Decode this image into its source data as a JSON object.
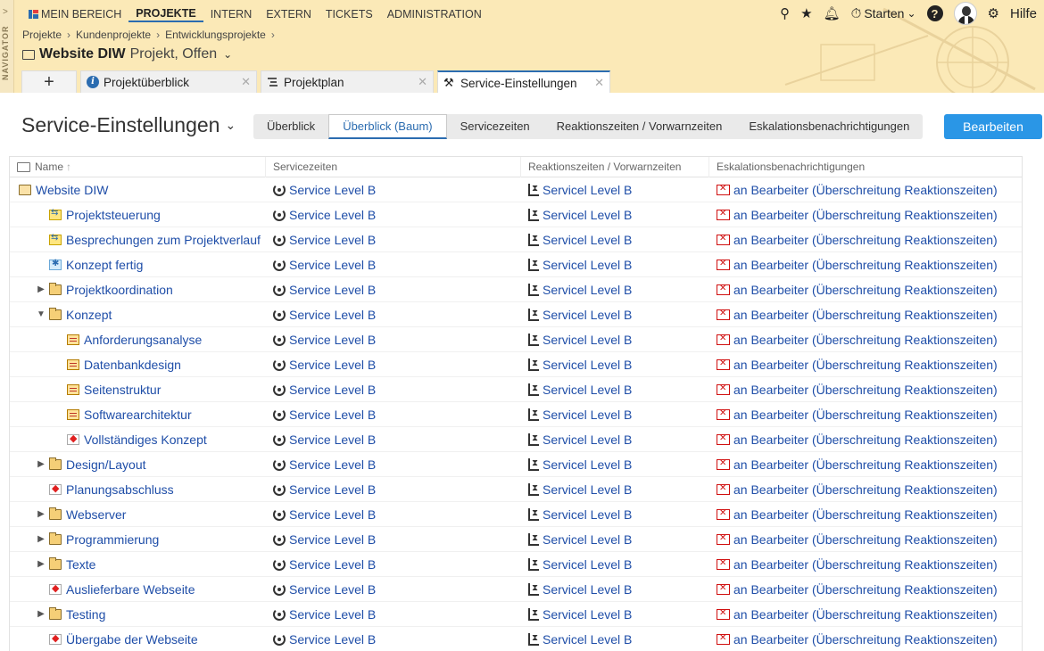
{
  "navigator": {
    "label": "NAVIGATOR"
  },
  "topnav": {
    "items": [
      "MEIN BEREICH",
      "PROJEKTE",
      "INTERN",
      "EXTERN",
      "TICKETS",
      "ADMINISTRATION"
    ],
    "active": "PROJEKTE"
  },
  "tools": {
    "start_label": "Starten",
    "help_label": "Hilfe"
  },
  "breadcrumb": [
    "Projekte",
    "Kundenprojekte",
    "Entwicklungsprojekte"
  ],
  "project": {
    "name": "Website DIW",
    "status": "Projekt, Offen"
  },
  "tabs": [
    "Projektüberblick",
    "Projektplan",
    "Service-Einstellungen"
  ],
  "page": {
    "title": "Service-Einstellungen",
    "view_tabs": [
      "Überblick",
      "Überblick (Baum)",
      "Servicezeiten",
      "Reaktionszeiten / Vorwarnzeiten",
      "Eskalationsbenachrichtigungen"
    ],
    "edit_label": "Bearbeiten"
  },
  "table": {
    "headers": [
      "Name",
      "Servicezeiten",
      "Reaktionszeiten / Vorwarnzeiten",
      "Eskalationsbenachrichtigungen"
    ],
    "rows": [
      {
        "name": "Website DIW",
        "type": "root",
        "indent": 0,
        "expander": "",
        "service": "Service Level B",
        "reaction": "Servicel Level B",
        "escalation": "an Bearbeiter (Überschreitung Reaktionszeiten)"
      },
      {
        "name": "Projektsteuerung",
        "type": "meet",
        "indent": 1,
        "expander": "",
        "service": "Service Level B",
        "reaction": "Servicel Level B",
        "escalation": "an Bearbeiter (Überschreitung Reaktionszeiten)"
      },
      {
        "name": "Besprechungen zum Projektverlauf",
        "type": "meet",
        "indent": 1,
        "expander": "",
        "service": "Service Level B",
        "reaction": "Servicel Level B",
        "escalation": "an Bearbeiter (Überschreitung Reaktionszeiten)"
      },
      {
        "name": "Konzept fertig",
        "type": "concept",
        "indent": 1,
        "expander": "",
        "service": "Service Level B",
        "reaction": "Servicel Level B",
        "escalation": "an Bearbeiter (Überschreitung Reaktionszeiten)"
      },
      {
        "name": "Projektkoordination",
        "type": "folder",
        "indent": 1,
        "expander": "▶",
        "service": "Service Level B",
        "reaction": "Servicel Level B",
        "escalation": "an Bearbeiter (Überschreitung Reaktionszeiten)"
      },
      {
        "name": "Konzept",
        "type": "folder",
        "indent": 1,
        "expander": "▼",
        "service": "Service Level B",
        "reaction": "Servicel Level B",
        "escalation": "an Bearbeiter (Überschreitung Reaktionszeiten)"
      },
      {
        "name": "Anforderungsanalyse",
        "type": "task",
        "indent": 2,
        "expander": "",
        "service": "Service Level B",
        "reaction": "Servicel Level B",
        "escalation": "an Bearbeiter (Überschreitung Reaktionszeiten)"
      },
      {
        "name": "Datenbankdesign",
        "type": "task",
        "indent": 2,
        "expander": "",
        "service": "Service Level B",
        "reaction": "Servicel Level B",
        "escalation": "an Bearbeiter (Überschreitung Reaktionszeiten)"
      },
      {
        "name": "Seitenstruktur",
        "type": "task",
        "indent": 2,
        "expander": "",
        "service": "Service Level B",
        "reaction": "Servicel Level B",
        "escalation": "an Bearbeiter (Überschreitung Reaktionszeiten)"
      },
      {
        "name": "Softwarearchitektur",
        "type": "task",
        "indent": 2,
        "expander": "",
        "service": "Service Level B",
        "reaction": "Servicel Level B",
        "escalation": "an Bearbeiter (Überschreitung Reaktionszeiten)"
      },
      {
        "name": "Vollständiges Konzept",
        "type": "milestone",
        "indent": 2,
        "expander": "",
        "service": "Service Level B",
        "reaction": "Servicel Level B",
        "escalation": "an Bearbeiter (Überschreitung Reaktionszeiten)"
      },
      {
        "name": "Design/Layout",
        "type": "folder",
        "indent": 1,
        "expander": "▶",
        "service": "Service Level B",
        "reaction": "Servicel Level B",
        "escalation": "an Bearbeiter (Überschreitung Reaktionszeiten)"
      },
      {
        "name": "Planungsabschluss",
        "type": "milestone",
        "indent": 1,
        "expander": "",
        "service": "Service Level B",
        "reaction": "Servicel Level B",
        "escalation": "an Bearbeiter (Überschreitung Reaktionszeiten)"
      },
      {
        "name": "Webserver",
        "type": "folder",
        "indent": 1,
        "expander": "▶",
        "service": "Service Level B",
        "reaction": "Servicel Level B",
        "escalation": "an Bearbeiter (Überschreitung Reaktionszeiten)"
      },
      {
        "name": "Programmierung",
        "type": "folder",
        "indent": 1,
        "expander": "▶",
        "service": "Service Level B",
        "reaction": "Servicel Level B",
        "escalation": "an Bearbeiter (Überschreitung Reaktionszeiten)"
      },
      {
        "name": "Texte",
        "type": "folder",
        "indent": 1,
        "expander": "▶",
        "service": "Service Level B",
        "reaction": "Servicel Level B",
        "escalation": "an Bearbeiter (Überschreitung Reaktionszeiten)"
      },
      {
        "name": "Auslieferbare Webseite",
        "type": "milestone",
        "indent": 1,
        "expander": "",
        "service": "Service Level B",
        "reaction": "Servicel Level B",
        "escalation": "an Bearbeiter (Überschreitung Reaktionszeiten)"
      },
      {
        "name": "Testing",
        "type": "folder",
        "indent": 1,
        "expander": "▶",
        "service": "Service Level B",
        "reaction": "Servicel Level B",
        "escalation": "an Bearbeiter (Überschreitung Reaktionszeiten)"
      },
      {
        "name": "Übergabe der Webseite",
        "type": "milestone",
        "indent": 1,
        "expander": "",
        "service": "Service Level B",
        "reaction": "Servicel Level B",
        "escalation": "an Bearbeiter (Überschreitung Reaktionszeiten)"
      }
    ]
  }
}
